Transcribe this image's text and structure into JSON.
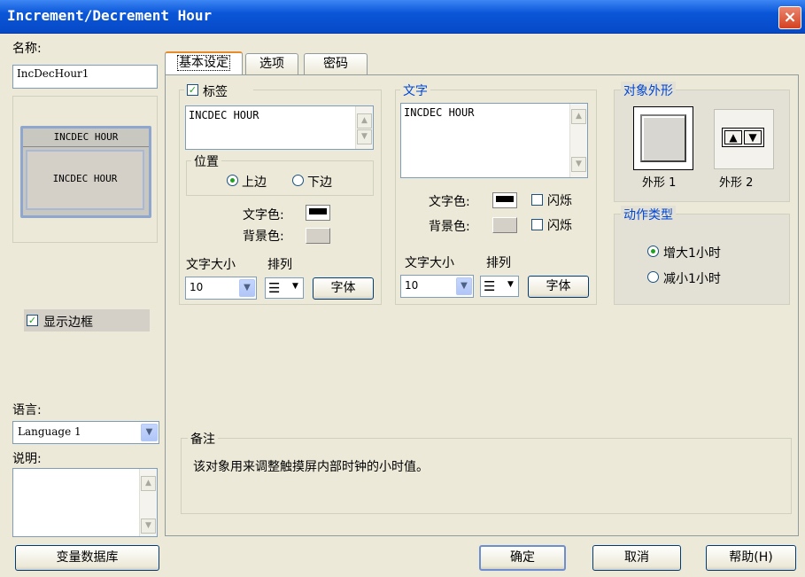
{
  "window": {
    "title": "Increment/Decrement Hour",
    "close_glyph": "×"
  },
  "left": {
    "name_label": "名称:",
    "name_value": "IncDecHour1",
    "preview": {
      "top_text": "INCDEC HOUR",
      "main_text": "INCDEC HOUR"
    },
    "show_border_label": "显示边框",
    "language_label": "语言:",
    "language_value": "Language 1",
    "description_label": "说明:",
    "variable_db_button": "变量数据库"
  },
  "tabs": [
    {
      "label": "基本设定",
      "active": true
    },
    {
      "label": "选项",
      "active": false
    },
    {
      "label": "密码",
      "active": false
    }
  ],
  "label_group": {
    "title": "标签",
    "text": "INCDEC HOUR",
    "position_title": "位置",
    "top_option": "上边",
    "bottom_option": "下边",
    "text_color_label": "文字色:",
    "bg_color_label": "背景色:",
    "font_size_label": "文字大小",
    "align_label": "排列",
    "font_size_value": "10",
    "font_button": "字体"
  },
  "text_group": {
    "title": "文字",
    "text": "INCDEC HOUR",
    "text_color_label": "文字色:",
    "bg_color_label": "背景色:",
    "blink_label_1": "闪烁",
    "blink_label_2": "闪烁",
    "font_size_label": "文字大小",
    "align_label": "排列",
    "font_size_value": "10",
    "font_button": "字体"
  },
  "shape_group": {
    "title": "对象外形",
    "shape1_label": "外形 1",
    "shape2_label": "外形 2"
  },
  "action_group": {
    "title": "动作类型",
    "option_increase": "增大1小时",
    "option_decrease": "减小1小时"
  },
  "notes": {
    "title": "备注",
    "text": "该对象用来调整触摸屏内部时钟的小时值。"
  },
  "buttons": {
    "ok": "确定",
    "cancel": "取消",
    "help": "帮助(H)"
  },
  "colors": {
    "title_bar": "#0a56d8",
    "dialog_bg": "#ece9d8",
    "text_color_swatch": "#000000",
    "bg_color_swatch": "#d4d0c8",
    "check_green": "#21a121"
  }
}
